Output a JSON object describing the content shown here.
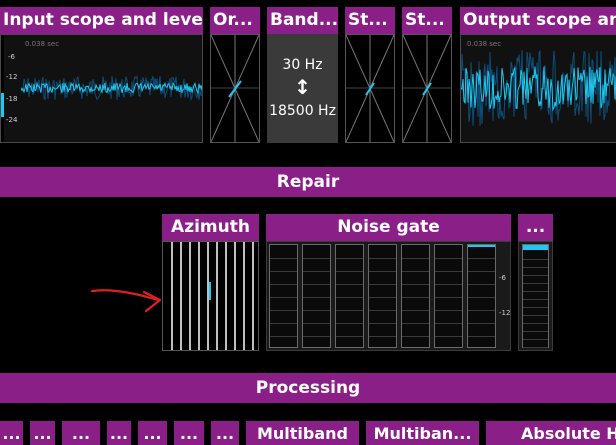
{
  "top_modules": {
    "input_scope": {
      "title": "Input scope and levels",
      "time_label": "0.038 sec",
      "ticks": [
        "-6",
        "-12",
        "-18",
        "-24"
      ]
    },
    "orientation": {
      "title": "Or..."
    },
    "band": {
      "title": "Band...",
      "low": "30 Hz",
      "high": "18500 Hz",
      "arrow": "↕"
    },
    "stereo1": {
      "title": "St..."
    },
    "stereo2": {
      "title": "St..."
    },
    "output_scope": {
      "title": "Output scope and levels",
      "time_label": "0.038 sec"
    }
  },
  "sections": {
    "repair": "Repair",
    "processing": "Processing"
  },
  "repair_modules": {
    "azimuth": {
      "title": "Azimuth"
    },
    "noise_gate": {
      "title": "Noise gate",
      "ticks": [
        "-6",
        "-12"
      ]
    },
    "more": {
      "title": "..."
    }
  },
  "processing_modules": {
    "items": [
      "...",
      "...",
      "...",
      "...",
      "...",
      "...",
      "..."
    ],
    "multiband1": "Multiband",
    "multiband2": "Multiban...",
    "absolute": "Absolute H"
  },
  "colors": {
    "accent": "#8a1f87",
    "waveform": "#1ec8f0",
    "annotation": "#e02020"
  }
}
